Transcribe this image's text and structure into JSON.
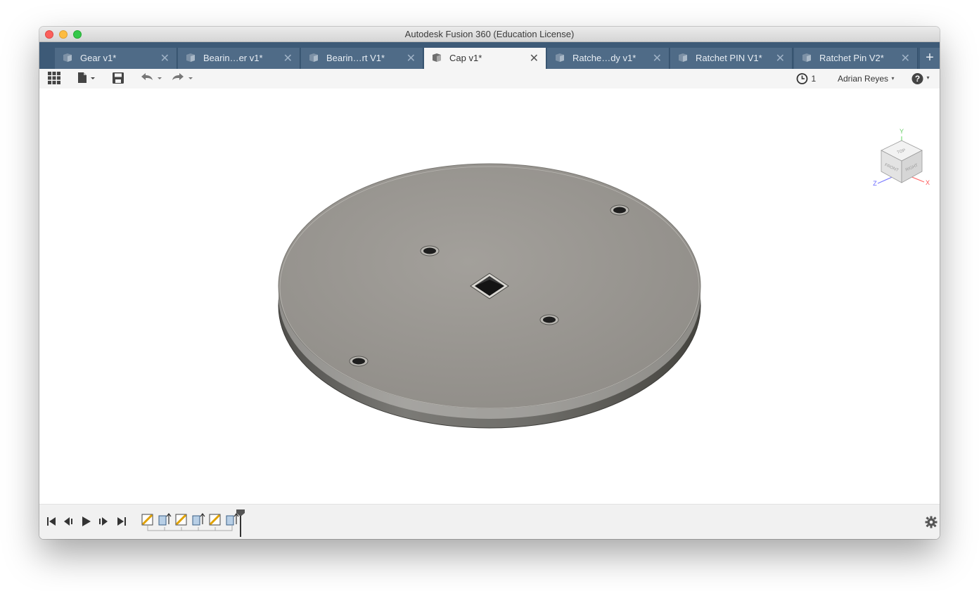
{
  "window": {
    "title": "Autodesk Fusion 360 (Education License)"
  },
  "tabs": [
    {
      "label": "Gear v1*",
      "close": "✕"
    },
    {
      "label": "Bearin…er v1*",
      "close": "✕"
    },
    {
      "label": "Bearin…rt V1*",
      "close": "✕"
    },
    {
      "label": "Cap v1*",
      "close": "✕",
      "active": true
    },
    {
      "label": "Ratche…dy v1*",
      "close": "✕"
    },
    {
      "label": "Ratchet PIN V1*",
      "close": "✕"
    },
    {
      "label": "Ratchet Pin V2*",
      "close": "✕"
    }
  ],
  "tab_add": "+",
  "toolbar": {
    "job_count": "1",
    "user_name": "Adrian Reyes",
    "user_caret": "▾",
    "help_caret": "▾"
  },
  "viewcube": {
    "faces": {
      "top": "TOP",
      "front": "FRONT",
      "right": "RIGHT"
    },
    "axes": {
      "x": "X",
      "y": "Y",
      "z": "Z"
    }
  },
  "timeline": {
    "features": [
      "sketch",
      "extrude",
      "sketch",
      "extrude",
      "sketch",
      "extrude"
    ]
  },
  "colors": {
    "tabbar": "#3d5a77",
    "tab": "#4f6b87",
    "tab_active": "#f5f5f5",
    "part_top": "#9b9893",
    "part_side": "#6b6a67"
  }
}
